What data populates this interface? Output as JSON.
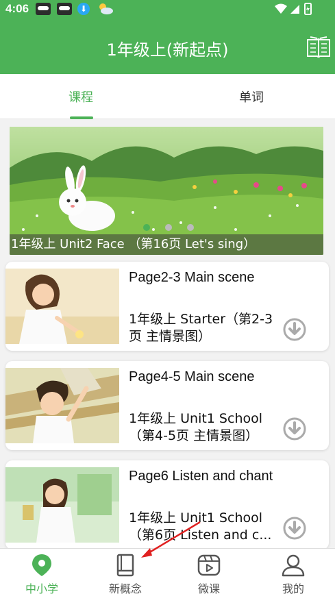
{
  "status_bar": {
    "time": "4:06"
  },
  "app_bar": {
    "title": "1年级上(新起点)"
  },
  "tabs": [
    {
      "label": "课程",
      "active": true
    },
    {
      "label": "单词",
      "active": false
    }
  ],
  "banner": {
    "caption": "1年级上 Unit2 Face （第16页 Let's sing）",
    "page_indicator": {
      "count": 3,
      "active_index": 0
    }
  },
  "lessons": [
    {
      "title": "Page2-3 Main scene",
      "description": "1年级上 Starter（第2-3页 主情景图）"
    },
    {
      "title": "Page4-5 Main scene",
      "description": "1年级上 Unit1 School（第4-5页 主情景图）"
    },
    {
      "title": "Page6 Listen and chant",
      "description": "1年级上 Unit1 School（第6页 Listen and c..."
    }
  ],
  "bottom_nav": [
    {
      "label": "中小学",
      "icon": "location-pin-icon",
      "active": true
    },
    {
      "label": "新概念",
      "icon": "book-icon",
      "active": false
    },
    {
      "label": "微课",
      "icon": "video-play-icon",
      "active": false
    },
    {
      "label": "我的",
      "icon": "person-icon",
      "active": false
    }
  ],
  "colors": {
    "accent": "#4cb257",
    "arrow": "#e02020"
  }
}
